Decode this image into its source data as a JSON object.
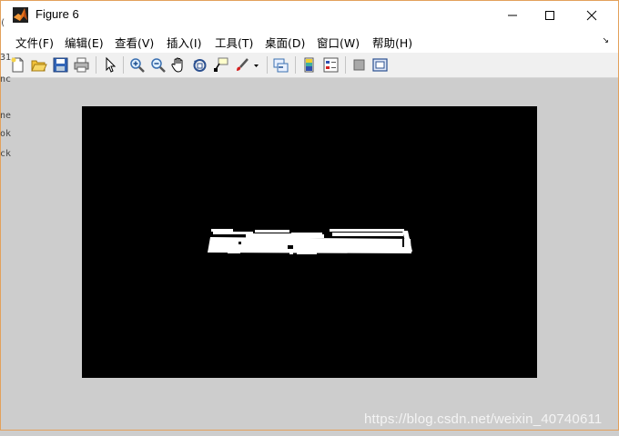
{
  "window": {
    "title": "Figure 6",
    "controls": [
      "minimize",
      "maximize",
      "close"
    ]
  },
  "menubar": {
    "items": [
      {
        "label": "文件(F)"
      },
      {
        "label": "编辑(E)"
      },
      {
        "label": "查看(V)"
      },
      {
        "label": "插入(I)"
      },
      {
        "label": "工具(T)"
      },
      {
        "label": "桌面(D)"
      },
      {
        "label": "窗口(W)"
      },
      {
        "label": "帮助(H)"
      }
    ],
    "overflow_arrow": "↘"
  },
  "toolbar": {
    "buttons": [
      "new-figure-icon",
      "open-file-icon",
      "save-icon",
      "print-icon",
      "edit-plot-icon",
      "zoom-in-icon",
      "zoom-out-icon",
      "pan-icon",
      "rotate-3d-icon",
      "data-cursor-icon",
      "brush-icon",
      "link-plot-icon",
      "insert-colorbar-icon",
      "insert-legend-icon",
      "hide-plot-tools-icon",
      "show-plot-tools-icon"
    ]
  },
  "background_fragments": [
    "31",
    "(",
    "nc",
    "ne",
    "ok",
    "ck"
  ],
  "figure": {
    "image_description_colors": {
      "background": "#000000",
      "foreground": "#ffffff"
    }
  },
  "watermark": "https://blog.csdn.net/weixin_40740611"
}
